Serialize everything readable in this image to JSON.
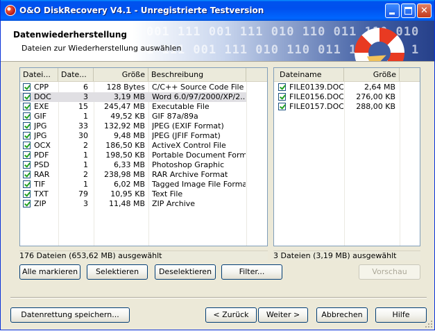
{
  "window": {
    "title": "O&O DiskRecovery V4.1 - Unregistrierte Testversion"
  },
  "header": {
    "title": "Datenwiederherstellung",
    "subtitle": "Dateien zur Wiederherstellung auswählen",
    "binary_line1": "001 111 001 111 010 110 011 110 010",
    "binary_line2": "1 111 001 111 010 110 011 110 010 1"
  },
  "types_table": {
    "columns": [
      "Datei...",
      "Date...",
      "Größe",
      "Beschreibung"
    ],
    "rows": [
      {
        "type": "CPP",
        "count": "6",
        "size": "128 Bytes",
        "desc": "C/C++ Source Code File",
        "checked": true
      },
      {
        "type": "DOC",
        "count": "3",
        "size": "3,19 MB",
        "desc": "Word 6.0/97/2000/XP/2...",
        "checked": true,
        "selected": true
      },
      {
        "type": "EXE",
        "count": "15",
        "size": "245,47 MB",
        "desc": "Executable File",
        "checked": true
      },
      {
        "type": "GIF",
        "count": "1",
        "size": "49,52 KB",
        "desc": "GIF 87a/89a",
        "checked": true
      },
      {
        "type": "JPG",
        "count": "33",
        "size": "132,92 MB",
        "desc": "JPEG (EXIF Format)",
        "checked": true
      },
      {
        "type": "JPG",
        "count": "30",
        "size": "9,48 MB",
        "desc": "JPEG (JFIF Format)",
        "checked": true
      },
      {
        "type": "OCX",
        "count": "2",
        "size": "186,50 KB",
        "desc": "ActiveX Control File",
        "checked": true
      },
      {
        "type": "PDF",
        "count": "1",
        "size": "198,50 KB",
        "desc": "Portable Document Format",
        "checked": true
      },
      {
        "type": "PSD",
        "count": "1",
        "size": "6,33 MB",
        "desc": "Photoshop Graphic",
        "checked": true
      },
      {
        "type": "RAR",
        "count": "2",
        "size": "238,98 MB",
        "desc": "RAR Archive Format",
        "checked": true
      },
      {
        "type": "TIF",
        "count": "1",
        "size": "6,02 MB",
        "desc": "Tagged Image File Format",
        "checked": true
      },
      {
        "type": "TXT",
        "count": "79",
        "size": "10,95 KB",
        "desc": "Text File",
        "checked": true
      },
      {
        "type": "ZIP",
        "count": "3",
        "size": "11,48 MB",
        "desc": "ZIP Archive",
        "checked": true
      }
    ],
    "status": "176 Dateien (653,62 MB) ausgewählt"
  },
  "files_table": {
    "columns": [
      "Dateiname",
      "Größe"
    ],
    "rows": [
      {
        "name": "FILE0139.DOC",
        "size": "2,64 MB",
        "checked": true
      },
      {
        "name": "FILE0156.DOC",
        "size": "276,00 KB",
        "checked": true
      },
      {
        "name": "FILE0157.DOC",
        "size": "288,00 KB",
        "checked": true
      }
    ],
    "status": "3 Dateien (3,19 MB) ausgewählt"
  },
  "buttons": {
    "mark_all": "Alle markieren",
    "select": "Selektieren",
    "deselect": "Deselektieren",
    "filter": "Filter...",
    "preview": "Vorschau",
    "save": "Datenrettung speichern...",
    "back": "< Zurück",
    "next": "Weiter >",
    "cancel": "Abbrechen",
    "help": "Hilfe"
  },
  "colors": {
    "titlebar": "#0054e3",
    "selection": "#e0dfe3",
    "check": "#21a121"
  },
  "icons": [
    "app-icon",
    "minimize-icon",
    "maximize-icon",
    "close-icon",
    "lifebuoy-icon",
    "resize-grip-icon"
  ]
}
